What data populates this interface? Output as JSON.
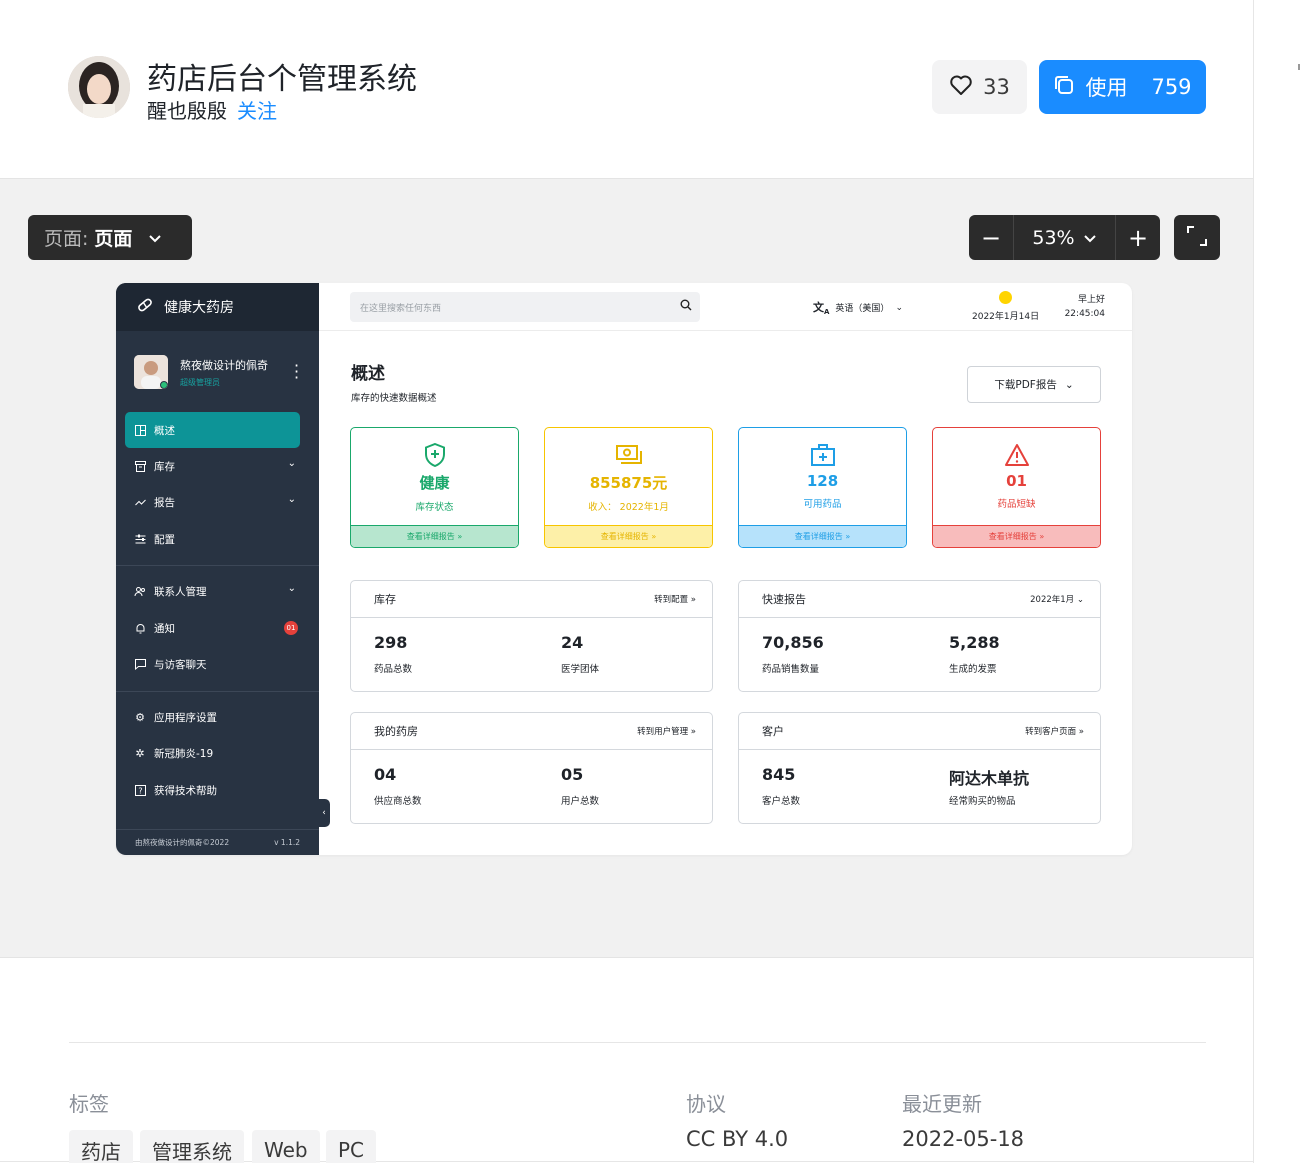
{
  "header": {
    "title": "药店后台个管理系统",
    "author": "醒也殷殷",
    "follow": "关注",
    "likes": "33",
    "use_label": "使用",
    "use_count": "759"
  },
  "toolbar": {
    "page_label": "页面:",
    "page_value": "页面",
    "zoom": "53%",
    "zoom_out": "−",
    "zoom_in": "+"
  },
  "mockup": {
    "brand": "健康大药房",
    "user_name": "熬夜做设计的佩奇",
    "user_role": "超级管理员",
    "nav": [
      {
        "label": "概述"
      },
      {
        "label": "库存"
      },
      {
        "label": "报告"
      },
      {
        "label": "配置"
      },
      {
        "label": "联系人管理"
      },
      {
        "label": "通知",
        "badge": "01"
      },
      {
        "label": "与访客聊天"
      },
      {
        "label": "应用程序设置"
      },
      {
        "label": "新冠肺炎-19"
      },
      {
        "label": "获得技术帮助"
      }
    ],
    "footer_left": "由熬夜做设计的佩奇©2022",
    "footer_right": "v 1.1.2",
    "search_placeholder": "在这里搜索任何东西",
    "language": "英语（美国）",
    "date": "2022年1月14日",
    "greeting": "早上好",
    "time": "22:45:04",
    "overview_title": "概述",
    "overview_sub": "库存的快速数据概述",
    "pdf_button": "下载PDF报告",
    "cards": [
      {
        "value": "健康",
        "label": "库存状态",
        "footer": "查看详细报告 »",
        "color": "#1aa86b"
      },
      {
        "value": "855875元",
        "label": "收入：  2022年1月",
        "footer": "查看详细报告 »",
        "color": "#f7c500"
      },
      {
        "value": "128",
        "label": "可用药品",
        "footer": "查看详细报告 »",
        "color": "#1e9ee6"
      },
      {
        "value": "01",
        "label": "药品短缺",
        "footer": "查看详细报告 »",
        "color": "#e5413b"
      }
    ],
    "panels": [
      {
        "title": "库存",
        "link": "转到配置 »",
        "v1": "298",
        "l1": "药品总数",
        "v2": "24",
        "l2": "医学团体"
      },
      {
        "title": "快速报告",
        "link": "2022年1月",
        "v1": "70,856",
        "l1": "药品销售数量",
        "v2": "5,288",
        "l2": "生成的发票"
      },
      {
        "title": "我的药房",
        "link": "转到用户管理 »",
        "v1": "04",
        "l1": "供应商总数",
        "v2": "05",
        "l2": "用户总数"
      },
      {
        "title": "客户",
        "link": "转到客户页面 »",
        "v1": "845",
        "l1": "客户总数",
        "v2": "阿达木单抗",
        "l2": "经常购买的物品"
      }
    ]
  },
  "footer": {
    "tags_label": "标签",
    "tags": [
      "药店",
      "管理系统",
      "Web",
      "PC"
    ],
    "license_label": "协议",
    "license": "CC BY 4.0",
    "updated_label": "最近更新",
    "updated": "2022-05-18"
  }
}
